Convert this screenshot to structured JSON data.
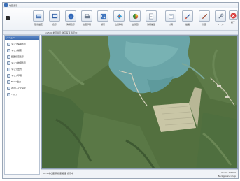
{
  "window": {
    "title": "地図表示"
  },
  "toolbar": {
    "buttons": [
      {
        "label": "環境設定",
        "icon": "settings-icon"
      },
      {
        "label": "表示",
        "icon": "display-icon"
      },
      {
        "label": "情報表示",
        "icon": "info-icon"
      },
      {
        "label": "地図印刷",
        "icon": "print-icon"
      },
      {
        "label": "検索",
        "icon": "search-icon"
      },
      {
        "label": "位置移動",
        "icon": "move-icon"
      },
      {
        "label": "主題図",
        "icon": "theme-map-icon"
      },
      {
        "label": "情報編集",
        "icon": "edit-info-icon"
      },
      {
        "label": "計測",
        "icon": "measure-icon"
      },
      {
        "label": "描画",
        "icon": "draw-icon"
      },
      {
        "label": "作図",
        "icon": "drafting-icon"
      },
      {
        "label": "ツール",
        "icon": "tool-icon"
      },
      {
        "label": "終了",
        "icon": "close-icon"
      }
    ]
  },
  "status": {
    "text": "1/2500 地図表示 航空写真 表示中"
  },
  "sidebar": {
    "header": "メニュー",
    "items": [
      {
        "label": "マップ情報表示"
      },
      {
        "label": "マップ検索"
      },
      {
        "label": "範囲指定表示"
      },
      {
        "label": "マップ地図表示"
      },
      {
        "label": "マップ出力"
      },
      {
        "label": "マップ印刷"
      },
      {
        "label": "Excel出力"
      },
      {
        "label": "表示レイヤ設定"
      },
      {
        "label": "ヘルプ"
      }
    ]
  },
  "bottom": {
    "left": "X:-1 中心座標 緯度 経度 表示中",
    "right": "Scale: 1/2500",
    "right2": "Background map"
  }
}
